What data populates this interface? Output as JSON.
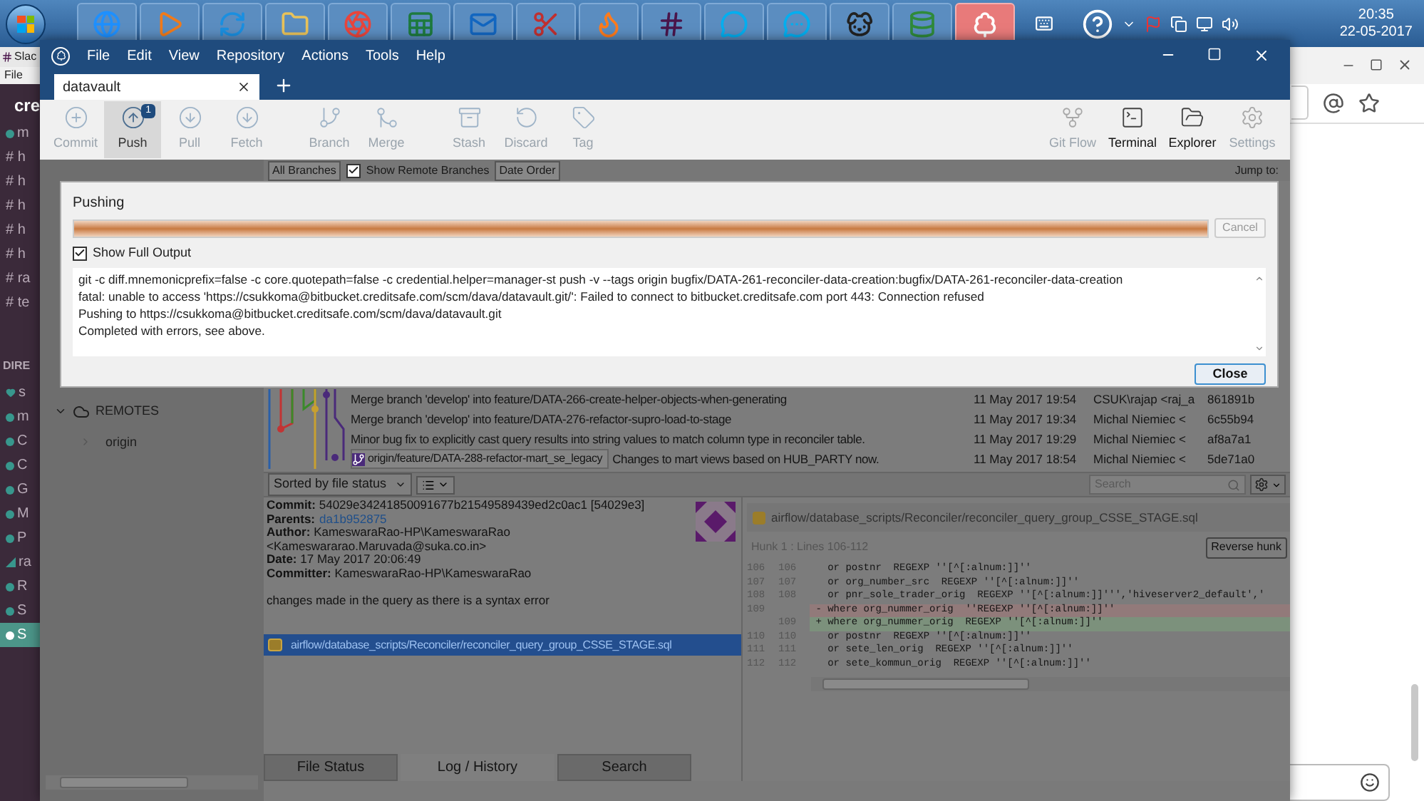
{
  "taskbar": {
    "apps": [
      {
        "selected": false
      },
      {
        "selected": false
      },
      {
        "selected": false
      },
      {
        "selected": false
      },
      {
        "selected": false
      },
      {
        "selected": false
      },
      {
        "selected": false
      },
      {
        "selected": false
      },
      {
        "selected": false
      },
      {
        "selected": false
      },
      {
        "selected": false
      },
      {
        "selected": false
      },
      {
        "selected": false
      },
      {
        "selected": false
      },
      {
        "selected": true
      }
    ],
    "clock": {
      "time": "20:35",
      "date": "22-05-2017"
    }
  },
  "slack": {
    "title": "Slac",
    "menu": "File",
    "workspace": "cre",
    "channels": [
      {
        "label": "m",
        "kind": "person",
        "selected": false
      },
      {
        "label": "# h",
        "kind": "channel",
        "selected": false
      },
      {
        "label": "# h",
        "kind": "channel",
        "selected": false
      },
      {
        "label": "# h",
        "kind": "channel",
        "selected": false
      },
      {
        "label": "# h",
        "kind": "channel",
        "selected": false
      },
      {
        "label": "# h",
        "kind": "channel",
        "selected": false
      },
      {
        "label": "# ra",
        "kind": "channel",
        "selected": false
      },
      {
        "label": "# te",
        "kind": "channel",
        "selected": false
      }
    ],
    "section": "DIRE",
    "dms": [
      {
        "label": "s",
        "kind": "heart",
        "selected": false
      },
      {
        "label": "m",
        "kind": "person",
        "selected": false
      },
      {
        "label": "C",
        "kind": "person",
        "selected": false
      },
      {
        "label": "C",
        "kind": "person",
        "selected": false
      },
      {
        "label": "G",
        "kind": "person",
        "selected": false
      },
      {
        "label": "M",
        "kind": "person",
        "selected": false
      },
      {
        "label": "P",
        "kind": "person",
        "selected": false
      },
      {
        "label": "ra",
        "kind": "triangle",
        "selected": false
      },
      {
        "label": "R",
        "kind": "person",
        "selected": false
      },
      {
        "label": "S",
        "kind": "person",
        "selected": false
      },
      {
        "label": "S",
        "kind": "person",
        "selected": true
      }
    ]
  },
  "sourcetree": {
    "menu": [
      "File",
      "Edit",
      "View",
      "Repository",
      "Actions",
      "Tools",
      "Help"
    ],
    "tabs": [
      {
        "label": "datavault",
        "selected": true
      }
    ],
    "toolbar_groups": [
      [
        {
          "label": "Commit",
          "disabled": true,
          "selected": false
        },
        {
          "label": "Push",
          "disabled": false,
          "selected": true,
          "badge": "1"
        },
        {
          "label": "Pull",
          "disabled": true,
          "selected": false
        },
        {
          "label": "Fetch",
          "disabled": true,
          "selected": false
        }
      ],
      [
        {
          "label": "Branch",
          "disabled": true,
          "selected": false
        },
        {
          "label": "Merge",
          "disabled": true,
          "selected": false
        }
      ],
      [
        {
          "label": "Stash",
          "disabled": true,
          "selected": false
        },
        {
          "label": "Discard",
          "disabled": true,
          "selected": false
        },
        {
          "label": "Tag",
          "disabled": true,
          "selected": false
        }
      ]
    ],
    "toolbar_right": [
      {
        "label": "Git Flow",
        "disabled": true
      },
      {
        "label": "Terminal",
        "disabled": false
      },
      {
        "label": "Explorer",
        "disabled": false
      },
      {
        "label": "Settings",
        "disabled": true
      }
    ],
    "filter_bar": {
      "branches": "All Branches",
      "remote": {
        "label": "Show Remote Branches",
        "checked": true
      },
      "order": "Date Order",
      "jump": "Jump to:"
    },
    "sidebar": {
      "section": "REMOTES",
      "expanded": true,
      "items": [
        {
          "label": "origin",
          "expanded": false
        }
      ]
    },
    "log_rows": [
      {
        "description": "Merge branch 'develop' into feature/DATA-266-create-helper-objects-when-generating",
        "date": "11 May 2017 19:54",
        "author": "CSUK\\rajap <raj_a",
        "commit": "861891b"
      },
      {
        "description": "Merge branch 'develop' into feature/DATA-276-refactor-supro-load-to-stage",
        "date": "11 May 2017 19:34",
        "author": "Michal Niemiec <",
        "commit": "6c55b94"
      },
      {
        "description": "Minor bug fix to explicitly cast query results into string values to match column type in reconciler table.",
        "date": "11 May 2017 19:29",
        "author": "Michal Niemiec <",
        "commit": "af8a7a1"
      },
      {
        "tag": "origin/feature/DATA-288-refactor-mart_se_legacy",
        "description": "Changes to mart views based on HUB_PARTY now.",
        "date": "11 May 2017 18:54",
        "author": "Michal Niemiec <",
        "commit": "5de71a0"
      }
    ],
    "sort": "Sorted by file status",
    "search_placeholder": "Search",
    "commit_info": [
      {
        "label": "Commit:",
        "value": "54029e34241850091677b21549589439ed2c0ac1 [54029e3]"
      },
      {
        "label": "Parents:",
        "value": "da1b952875",
        "kind": "link"
      },
      {
        "label": "Author:",
        "value": "KameswaraRao-HP\\KameswaraRao <Kameswararao.Maruvada@suka.co.in>"
      },
      {
        "label": "Date:",
        "value": "17 May 2017 20:06:49"
      },
      {
        "label": "Committer:",
        "value": "KameswaraRao-HP\\KameswaraRao"
      }
    ],
    "message": "changes made in the query as there is a syntax error",
    "files": [
      {
        "path": "airflow/database_scripts/Reconciler/reconciler_query_group_CSSE_STAGE.sql",
        "selected": true
      }
    ],
    "diff": {
      "file": "airflow/database_scripts/Reconciler/reconciler_query_group_CSSE_STAGE.sql",
      "hunk": "Hunk 1 : Lines 106-112",
      "reverse": "Reverse hunk",
      "lines": [
        {
          "kind": "context",
          "old": "106",
          "new": "106",
          "text": "   or postnr  REGEXP ''[^[:alnum:]]''"
        },
        {
          "kind": "context",
          "old": "107",
          "new": "107",
          "text": "   or org_number_src  REGEXP ''[^[:alnum:]]''"
        },
        {
          "kind": "context",
          "old": "108",
          "new": "108",
          "text": "   or pnr_sole_trader_orig  REGEXP ''[^[:alnum:]]''','hiveserver2_default','"
        },
        {
          "kind": "removed",
          "old": "109",
          "text": " - where org_nummer_orig  ''REGEXP ''[^[:alnum:]]''"
        },
        {
          "kind": "added",
          "new": "109",
          "text": " + where org_nummer_orig  REGEXP ''[^[:alnum:]]''"
        },
        {
          "kind": "context",
          "old": "110",
          "new": "110",
          "text": "   or postnr  REGEXP ''[^[:alnum:]]''"
        },
        {
          "kind": "context",
          "old": "111",
          "new": "111",
          "text": "   or sete_len_orig  REGEXP ''[^[:alnum:]]''"
        },
        {
          "kind": "context",
          "old": "112",
          "new": "112",
          "text": "   or sete_kommun_orig  REGEXP ''[^[:alnum:]]''"
        }
      ]
    },
    "bottom_tabs": [
      {
        "label": "File Status",
        "selected": false
      },
      {
        "label": "Log / History",
        "selected": true
      },
      {
        "label": "Search",
        "selected": false
      }
    ]
  },
  "dialog": {
    "title": "Pushing",
    "level": 1,
    "cancel": {
      "label": "Cancel",
      "disabled": true
    },
    "output_toggle": {
      "label": "Show Full Output",
      "checked": true
    },
    "output": [
      "git -c diff.mnemonicprefix=false -c core.quotepath=false -c credential.helper=manager-st push -v --tags origin bugfix/DATA-261-reconciler-data-creation:bugfix/DATA-261-reconciler-data-creation",
      "fatal: unable to access 'https://csukkoma@bitbucket.creditsafe.com/scm/dava/datavault.git/': Failed to connect to bitbucket.creditsafe.com port 443: Connection refused",
      "Pushing to https://csukkoma@bitbucket.creditsafe.com/scm/dava/datavault.git",
      "Completed with errors, see above."
    ],
    "close": "Close"
  }
}
